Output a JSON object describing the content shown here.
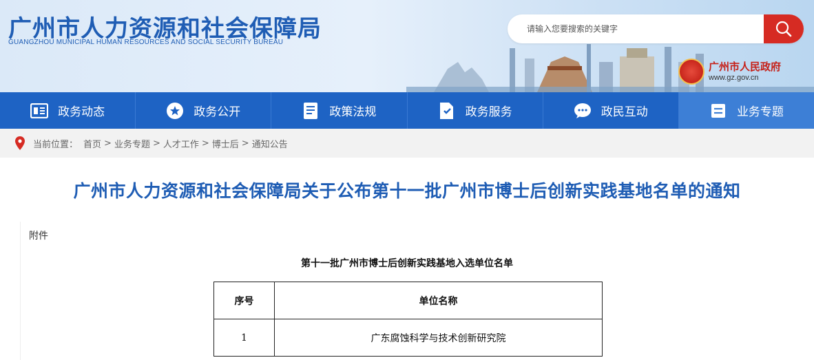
{
  "header": {
    "title": "广州市人力资源和社会保障局",
    "subtitle": "GUANGZHOU MUNICIPAL HUMAN RESOURCES AND SOCIAL SECURITY BUREAU",
    "search_placeholder": "请输入您要搜索的关键字",
    "gov_name": "广州市人民政府",
    "gov_url": "www.gz.gov.cn"
  },
  "nav": {
    "items": [
      {
        "label": "政务动态",
        "icon": "news-icon"
      },
      {
        "label": "政务公开",
        "icon": "star-icon"
      },
      {
        "label": "政策法规",
        "icon": "document-icon"
      },
      {
        "label": "政务服务",
        "icon": "service-icon"
      },
      {
        "label": "政民互动",
        "icon": "chat-icon"
      },
      {
        "label": "业务专题",
        "icon": "list-icon"
      }
    ]
  },
  "breadcrumb": {
    "prefix": "当前位置：",
    "items": [
      "首页",
      "业务专题",
      "人才工作",
      "博士后",
      "通知公告"
    ],
    "separator": ">"
  },
  "article": {
    "title": "广州市人力资源和社会保障局关于公布第十一批广州市博士后创新实践基地名单的通知",
    "attachment_label": "附件",
    "table_caption": "第十一批广州市博士后创新实践基地入选单位名单",
    "table": {
      "headers": [
        "序号",
        "单位名称"
      ],
      "rows": [
        [
          "1",
          "广东腐蚀科学与技术创新研究院"
        ]
      ]
    }
  },
  "colors": {
    "brand_blue": "#1f5db4",
    "nav_blue": "#1e63c4",
    "search_red": "#d62b23",
    "gov_red": "#c62119"
  }
}
